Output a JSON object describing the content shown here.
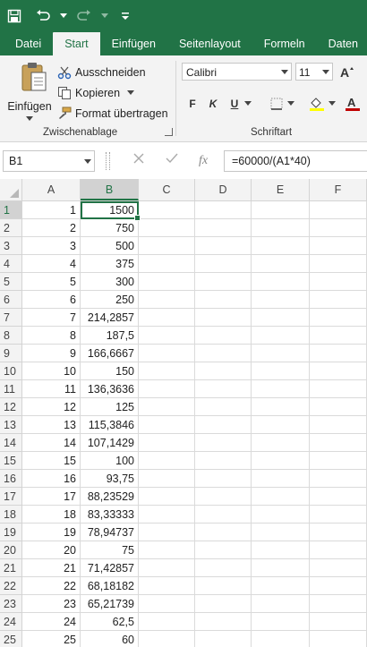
{
  "tabs": [
    "Datei",
    "Start",
    "Einfügen",
    "Seitenlayout",
    "Formeln",
    "Daten"
  ],
  "clipboard": {
    "paste": "Einfügen",
    "cut": "Ausschneiden",
    "copy": "Kopieren",
    "format_painter": "Format übertragen",
    "group_label": "Zwischenablage"
  },
  "font": {
    "name": "Calibri",
    "size": "11",
    "bold": "F",
    "italic": "K",
    "underline": "U",
    "group_label": "Schriftart"
  },
  "formula_bar": {
    "name_box": "B1",
    "fx": "fx",
    "formula": "=60000/(A1*40)"
  },
  "columns": [
    "A",
    "B",
    "C",
    "D",
    "E",
    "F"
  ],
  "rows": [
    {
      "n": "1",
      "a": "1",
      "b": "1500"
    },
    {
      "n": "2",
      "a": "2",
      "b": "750"
    },
    {
      "n": "3",
      "a": "3",
      "b": "500"
    },
    {
      "n": "4",
      "a": "4",
      "b": "375"
    },
    {
      "n": "5",
      "a": "5",
      "b": "300"
    },
    {
      "n": "6",
      "a": "6",
      "b": "250"
    },
    {
      "n": "7",
      "a": "7",
      "b": "214,2857"
    },
    {
      "n": "8",
      "a": "8",
      "b": "187,5"
    },
    {
      "n": "9",
      "a": "9",
      "b": "166,6667"
    },
    {
      "n": "10",
      "a": "10",
      "b": "150"
    },
    {
      "n": "11",
      "a": "11",
      "b": "136,3636"
    },
    {
      "n": "12",
      "a": "12",
      "b": "125"
    },
    {
      "n": "13",
      "a": "13",
      "b": "115,3846"
    },
    {
      "n": "14",
      "a": "14",
      "b": "107,1429"
    },
    {
      "n": "15",
      "a": "15",
      "b": "100"
    },
    {
      "n": "16",
      "a": "16",
      "b": "93,75"
    },
    {
      "n": "17",
      "a": "17",
      "b": "88,23529"
    },
    {
      "n": "18",
      "a": "18",
      "b": "83,33333"
    },
    {
      "n": "19",
      "a": "19",
      "b": "78,94737"
    },
    {
      "n": "20",
      "a": "20",
      "b": "75"
    },
    {
      "n": "21",
      "a": "21",
      "b": "71,42857"
    },
    {
      "n": "22",
      "a": "22",
      "b": "68,18182"
    },
    {
      "n": "23",
      "a": "23",
      "b": "65,21739"
    },
    {
      "n": "24",
      "a": "24",
      "b": "62,5"
    },
    {
      "n": "25",
      "a": "25",
      "b": "60"
    }
  ],
  "selected_cell": "B1",
  "colors": {
    "accent": "#217346",
    "font_color": "#c00000",
    "highlight": "#ffff00"
  }
}
